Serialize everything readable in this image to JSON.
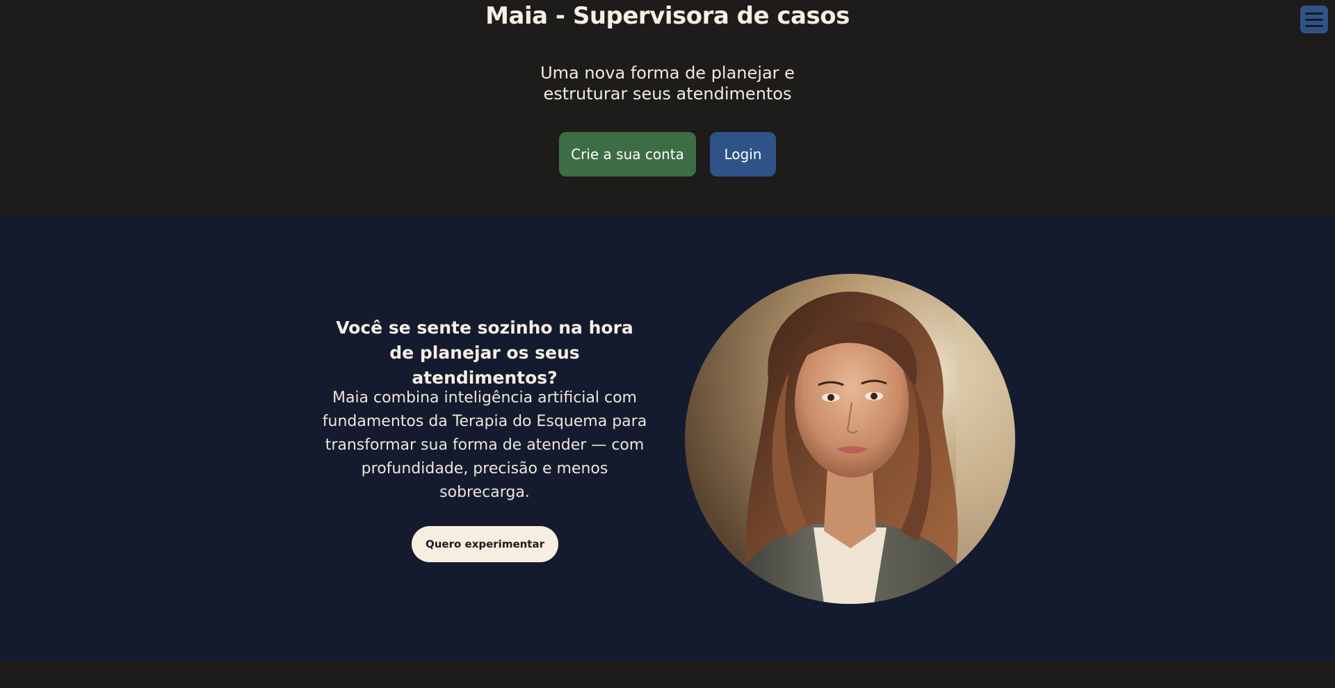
{
  "hero": {
    "title": "Maia - Supervisora de casos",
    "subtitle": "Uma nova forma de planejar e estruturar seus atendimentos",
    "signup_label": "Crie a sua conta",
    "login_label": "Login"
  },
  "menu": {
    "icon": "hamburger-menu-icon"
  },
  "feature": {
    "heading": "Você se sente sozinho na hora de planejar os seus atendimentos?",
    "body": "Maia combina inteligência artificial com fundamentos da Terapia do Esquema para transformar sua forma de atender — com profundidade, precisão e menos sobrecarga.",
    "cta_label": "Quero experimentar",
    "image": "woman-portrait"
  },
  "colors": {
    "page_background": "#1d1c1b",
    "feature_background": "#141b2e",
    "signup_button": "#3e6d45",
    "login_button": "#2f5388",
    "cta_button": "#f7ede0"
  }
}
